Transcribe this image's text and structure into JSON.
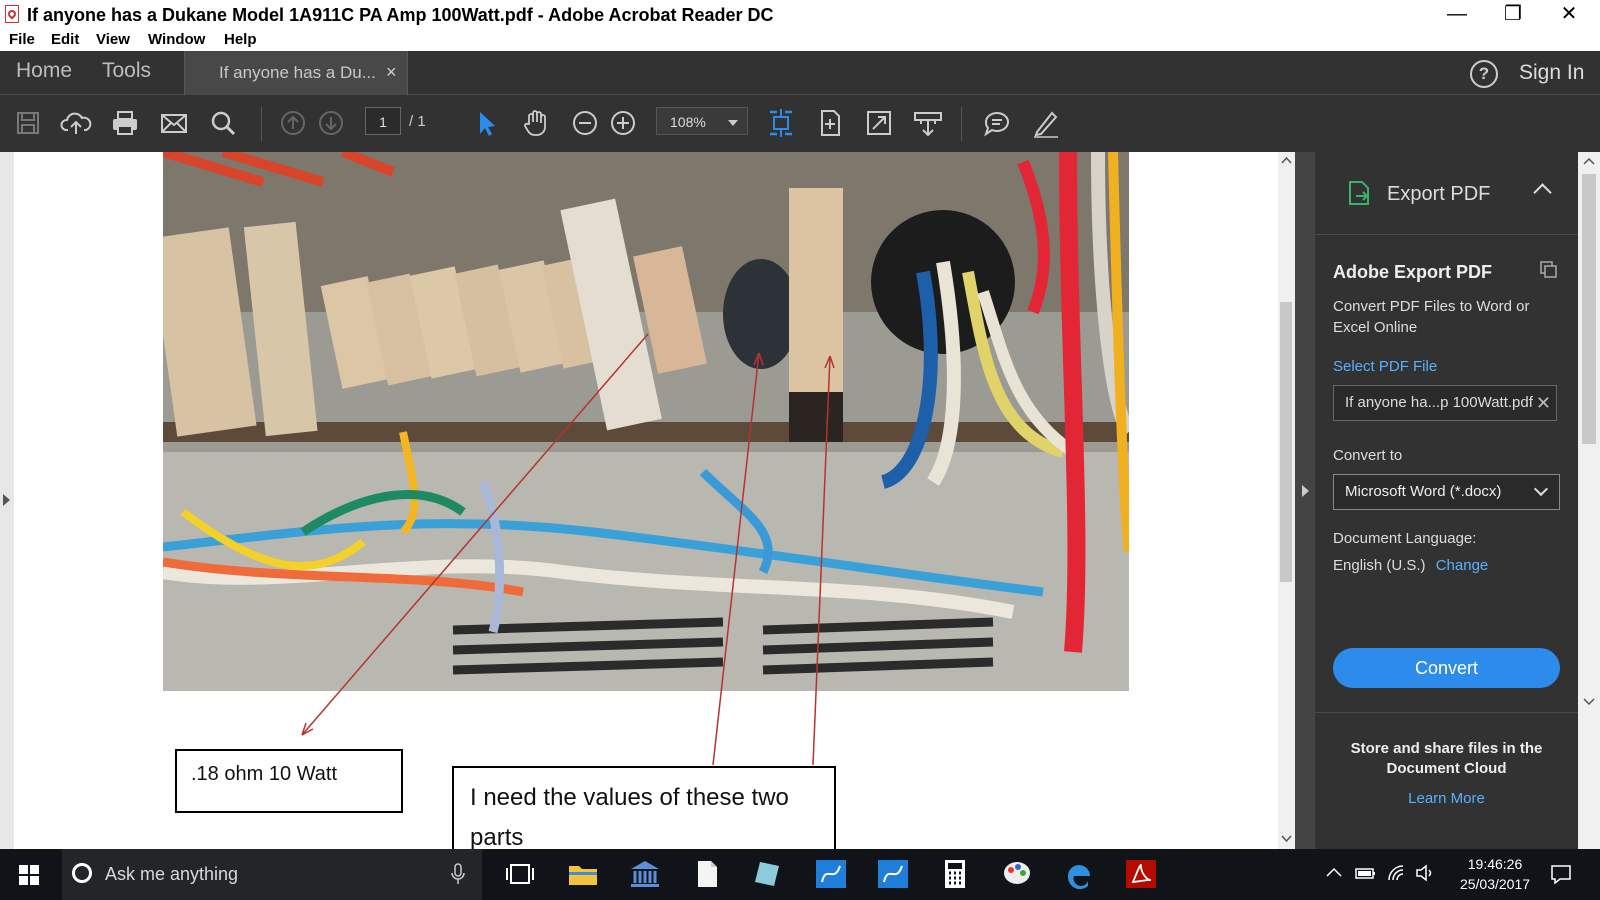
{
  "window": {
    "title": "If anyone has a Dukane Model 1A911C PA Amp 100Watt.pdf - Adobe Acrobat Reader DC",
    "minimize": "—",
    "maximize": "❐",
    "close": "✕"
  },
  "menu": [
    "File",
    "Edit",
    "View",
    "Window",
    "Help"
  ],
  "tabs": {
    "home": "Home",
    "tools": "Tools",
    "document": "If anyone has a Du...",
    "close": "×",
    "help": "?",
    "signin": "Sign In"
  },
  "toolbar": {
    "page_current": "1",
    "page_total": "/ 1",
    "zoom": "108%"
  },
  "document": {
    "callout_1": ".18 ohm 10 Watt",
    "callout_2": "I need the values of these two parts"
  },
  "export_panel": {
    "header": "Export PDF",
    "title": "Adobe Export PDF",
    "description": "Convert PDF Files to Word or Excel Online",
    "select_label": "Select PDF File",
    "file_name": "If anyone ha...p 100Watt.pdf",
    "convert_to_label": "Convert to",
    "convert_to_value": "Microsoft Word (*.docx)",
    "language_label": "Document Language:",
    "language_value": "English (U.S.)",
    "language_change": "Change",
    "convert_button": "Convert",
    "store_text": "Store and share files in the Document Cloud",
    "learn_more": "Learn More"
  },
  "taskbar": {
    "search_placeholder": "Ask me anything",
    "time": "19:46:26",
    "date": "25/03/2017"
  },
  "colors": {
    "accent_blue": "#2d8ceb",
    "link_blue": "#5ab0ff",
    "toolbar_dark": "#323232"
  }
}
